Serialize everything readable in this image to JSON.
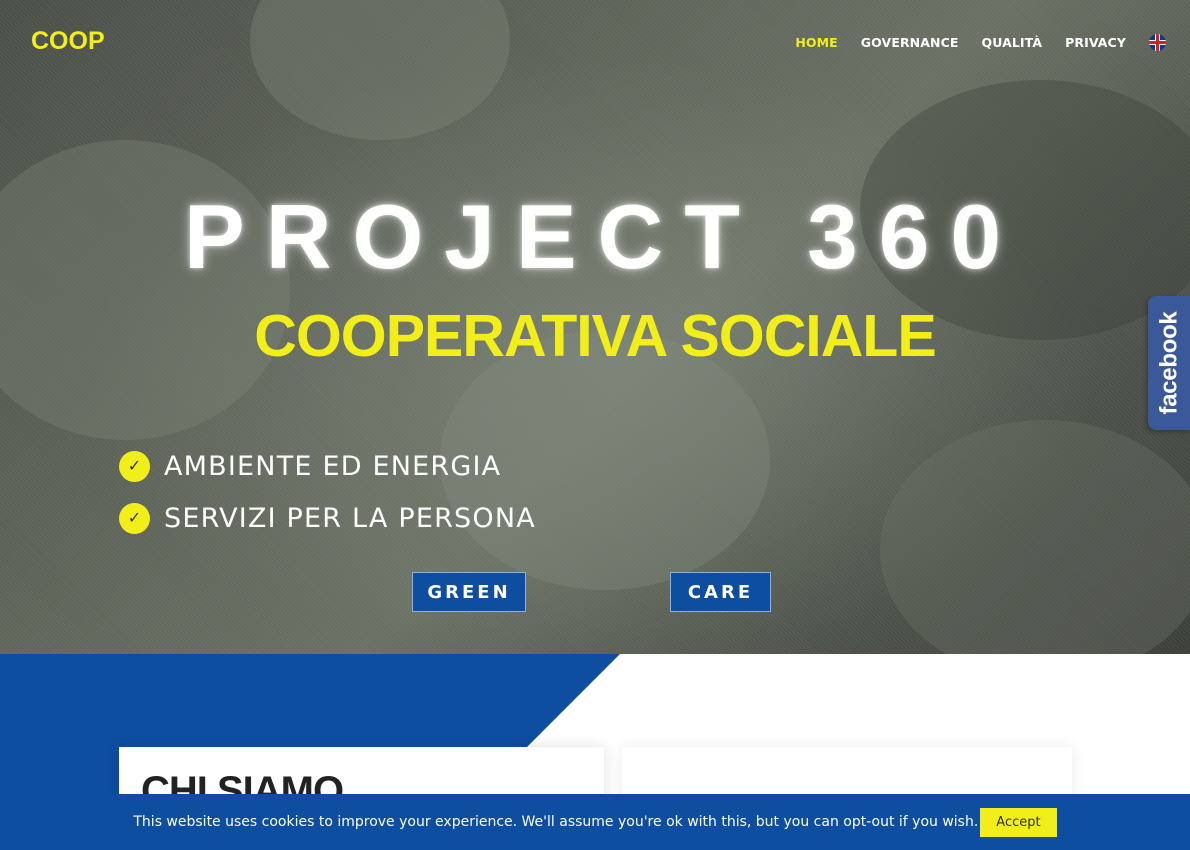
{
  "header": {
    "logo": "COOP",
    "nav": [
      {
        "label": "HOME"
      },
      {
        "label": "GOVERNANCE"
      },
      {
        "label": "QUALITÀ"
      },
      {
        "label": "PRIVACY"
      }
    ],
    "language_icon": "uk-flag-icon"
  },
  "hero": {
    "title": "PROJECT 360",
    "subtitle": "COOPERATIVA SOCIALE",
    "checks": [
      {
        "label": "AMBIENTE ED ENERGIA",
        "icon": "check-icon"
      },
      {
        "label": "SERVIZI PER LA PERSONA",
        "icon": "check-icon"
      }
    ],
    "buttons": {
      "green": "GREEN",
      "care": "CARE"
    }
  },
  "social": {
    "facebook": "facebook"
  },
  "section": {
    "title": "CHI SIAMO"
  },
  "cookie": {
    "text": "This website uses cookies to improve your experience. We'll assume you're ok with this, but you can opt-out if you wish.",
    "accept": "Accept"
  },
  "colors": {
    "accent_yellow": "#f2ee19",
    "brand_blue": "#0d4ea1",
    "facebook_blue": "#3b5998"
  }
}
